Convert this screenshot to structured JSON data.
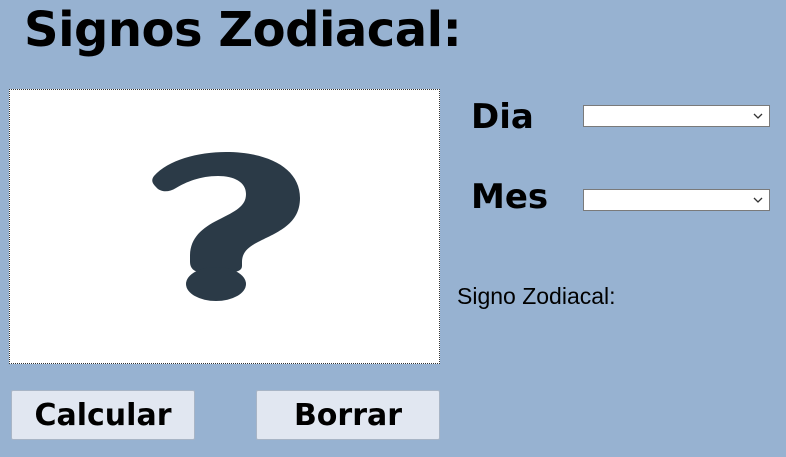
{
  "header": {
    "title": "Signos Zodiacal:"
  },
  "image": {
    "icon": "question-mark-icon",
    "color": "#2b3a47"
  },
  "form": {
    "dia_label": "Dia",
    "dia_value": "",
    "mes_label": "Mes",
    "mes_value": "",
    "result_label": "Signo Zodiacal:"
  },
  "buttons": {
    "calcular": "Calcular",
    "borrar": "Borrar"
  },
  "colors": {
    "background": "#97b2d1",
    "button": "#e1e7f1"
  }
}
